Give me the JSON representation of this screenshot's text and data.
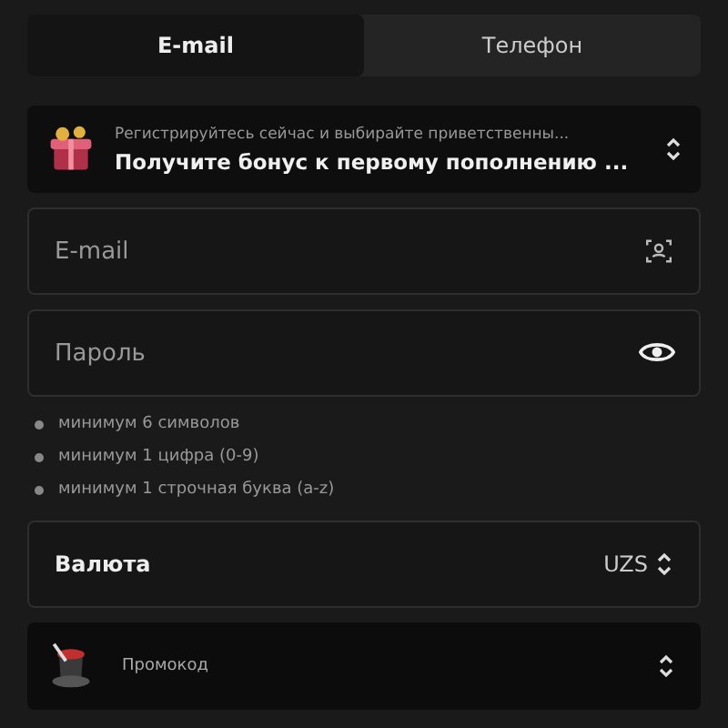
{
  "tabs": [
    {
      "label": "E-mail",
      "selected": true
    },
    {
      "label": "Телефон",
      "selected": false
    }
  ],
  "bonus": {
    "subtitle": "Регистрируйтесь сейчас и выбирайте приветственны...",
    "title": "Получите бонус к первому пополнению ..."
  },
  "email": {
    "placeholder": "E-mail"
  },
  "password": {
    "placeholder": "Пароль"
  },
  "rules": [
    "минимум 6 символов",
    "минимум 1 цифра (0-9)",
    "минимум 1 строчная буква (a-z)"
  ],
  "currency": {
    "label": "Валюта",
    "value": "UZS"
  },
  "promo": {
    "label": "Промокод"
  }
}
